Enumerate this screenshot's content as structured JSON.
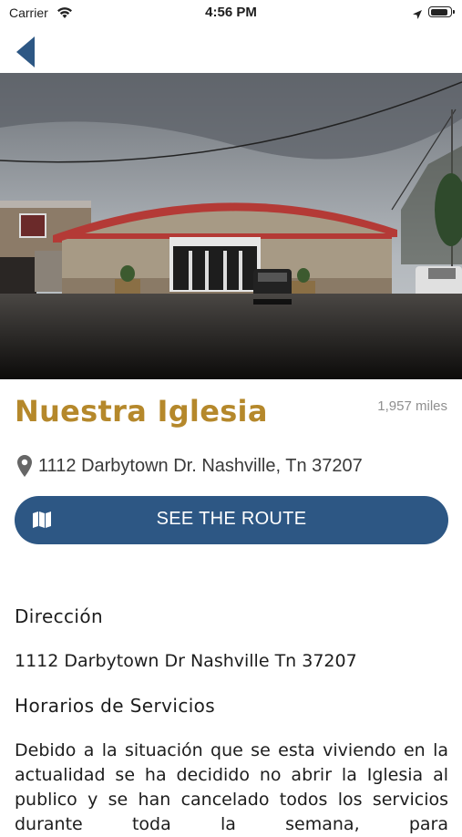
{
  "status_bar": {
    "carrier": "Carrier",
    "time": "4:56 PM"
  },
  "nav": {
    "back_icon": "chevron-left-icon"
  },
  "church": {
    "name": "Nuestra Iglesia",
    "distance": "1,957 miles",
    "address": "1112 Darbytown Dr. Nashville,  Tn 37207"
  },
  "route_button": {
    "label": "SEE THE ROUTE",
    "icon": "map-icon"
  },
  "details": {
    "direccion_heading": "Dirección",
    "direccion_value": "1112 Darbytown Dr Nashville Tn 37207",
    "horarios_heading": "Horarios de Servicios",
    "horarios_text": "Debido a la situación que se esta viviendo en la actualidad se ha decidido no abrir la Iglesia al publico y se han cancelado todos los servicios durante toda la semana, para"
  },
  "colors": {
    "accent_gold": "#b5882b",
    "button_blue": "#2d5784",
    "back_arrow_blue": "#2d5784"
  }
}
